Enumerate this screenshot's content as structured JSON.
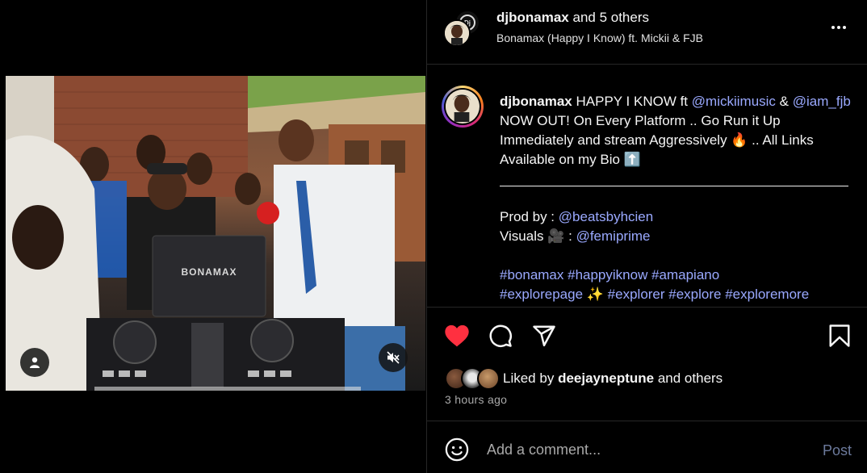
{
  "header": {
    "username": "djbonamax",
    "and_others": "and 5 others",
    "audio": "Bonamax (Happy I Know) ft. Mickii & FJB",
    "more_icon": "more-horizontal-icon"
  },
  "media": {
    "dj_brand": "BONAMAX",
    "user_tag_icon": "user-icon",
    "mute_icon": "speaker-muted-icon"
  },
  "caption": {
    "username": "djbonamax",
    "text1": "HAPPY I KNOW ft",
    "mention1": "@mickiimusic",
    "amp": "&",
    "mention2": "@iam_fjb",
    "text2": "NOW OUT! On Every Platform .. Go Run it Up Immediately and stream Aggressively 🔥 .. All Links Available on my Bio ⬆️",
    "prod_label": "Prod by :",
    "prod_mention": "@beatsbyhcien",
    "visuals_label": "Visuals 🎥 :",
    "visuals_mention": "@femiprime",
    "hashtags1": "#bonamax #happyiknow #amapiano",
    "hashtags2a": "#explorepage",
    "sparkle": "✨",
    "hashtags2b": "#explorer #explore #exploremore"
  },
  "actions": {
    "like_icon": "heart-filled-icon",
    "comment_icon": "comment-icon",
    "share_icon": "share-icon",
    "save_icon": "bookmark-icon",
    "liked_by_prefix": "Liked by",
    "liked_by_user": "deejayneptune",
    "liked_by_suffix": "and others",
    "time_ago": "3 hours ago"
  },
  "comment": {
    "placeholder": "Add a comment...",
    "post_label": "Post",
    "emoji_icon": "smiley-icon"
  },
  "colors": {
    "background": "#000000",
    "like_red": "#ff3040",
    "mention_blue": "#9aa9ff",
    "post_disabled": "#6c7a9c",
    "muted_text": "#a8a8a8"
  }
}
